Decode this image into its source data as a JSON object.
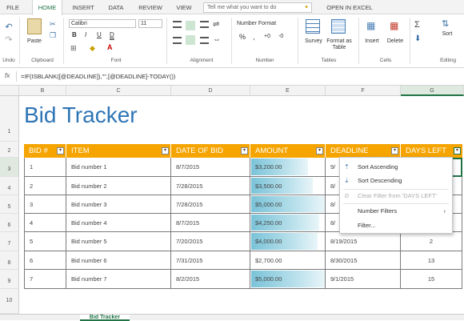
{
  "ribbon_tabs": [
    "FILE",
    "HOME",
    "INSERT",
    "DATA",
    "REVIEW",
    "VIEW"
  ],
  "tellme_placeholder": "Tell me what you want to do",
  "open_in_excel": "OPEN IN EXCEL",
  "ribbon": {
    "undo_label": "Undo",
    "paste_label": "Paste",
    "clipboard_label": "Clipboard",
    "font_name": "Calibri",
    "font_size": "11",
    "bold": "B",
    "italic": "I",
    "underline": "U",
    "double_underline": "D",
    "font_label": "Font",
    "alignment_label": "Alignment",
    "number_format": "Number Format",
    "number_label": "Number",
    "survey": "Survey",
    "format_as_table": "Format as Table",
    "tables_label": "Tables",
    "insert": "Insert",
    "delete": "Delete",
    "cells_label": "Cells",
    "sort": "Sort",
    "editing_label": "Editing"
  },
  "formula": {
    "fx": "fx",
    "text": "=IF(ISBLANK([@DEADLINE]),\"\",[@DEADLINE]-TODAY())"
  },
  "columns": [
    "B",
    "C",
    "D",
    "E",
    "F",
    "G"
  ],
  "rows": [
    "1",
    "2",
    "3",
    "4",
    "5",
    "6",
    "7",
    "8",
    "9",
    "10"
  ],
  "title": "Bid Tracker",
  "table": {
    "headers": [
      "BID #",
      "ITEM",
      "DATE OF BID",
      "AMOUNT",
      "DEADLINE",
      "DAYS LEFT"
    ],
    "rows": [
      {
        "bid": "1",
        "item": "Bid number 1",
        "date": "8/7/2015",
        "amount": "$3,200.00",
        "deadline": "9/",
        "days": "",
        "bar": 0.77
      },
      {
        "bid": "2",
        "item": "Bid number 2",
        "date": "7/28/2015",
        "amount": "$3,500.00",
        "deadline": "8/",
        "days": "",
        "bar": 0.84
      },
      {
        "bid": "3",
        "item": "Bid number 3",
        "date": "7/28/2015",
        "amount": "$5,000.00",
        "deadline": "8/",
        "days": "",
        "bar": 1.0
      },
      {
        "bid": "4",
        "item": "Bid number 4",
        "date": "8/7/2015",
        "amount": "$4,250.00",
        "deadline": "8/",
        "days": "",
        "bar": 0.92
      },
      {
        "bid": "5",
        "item": "Bid number 5",
        "date": "7/20/2015",
        "amount": "$4,000.00",
        "deadline": "8/19/2015",
        "days": "2",
        "bar": 0.9
      },
      {
        "bid": "6",
        "item": "Bid number 6",
        "date": "7/31/2015",
        "amount": "$2,700.00",
        "deadline": "8/30/2015",
        "days": "13",
        "bar": 0.0
      },
      {
        "bid": "7",
        "item": "Bid number 7",
        "date": "8/2/2015",
        "amount": "$5,000.00",
        "deadline": "9/1/2015",
        "days": "15",
        "bar": 1.0
      }
    ]
  },
  "menu": {
    "sort_asc": "Sort Ascending",
    "sort_desc": "Sort Descending",
    "clear_filter": "Clear Filter from 'DAYS LEFT'",
    "number_filters": "Number Filters",
    "filter": "Filter..."
  },
  "sheet_tab": "Bid Tracker",
  "colors": {
    "header": "#f5a400",
    "title": "#2e75b6",
    "accent": "#217346"
  }
}
